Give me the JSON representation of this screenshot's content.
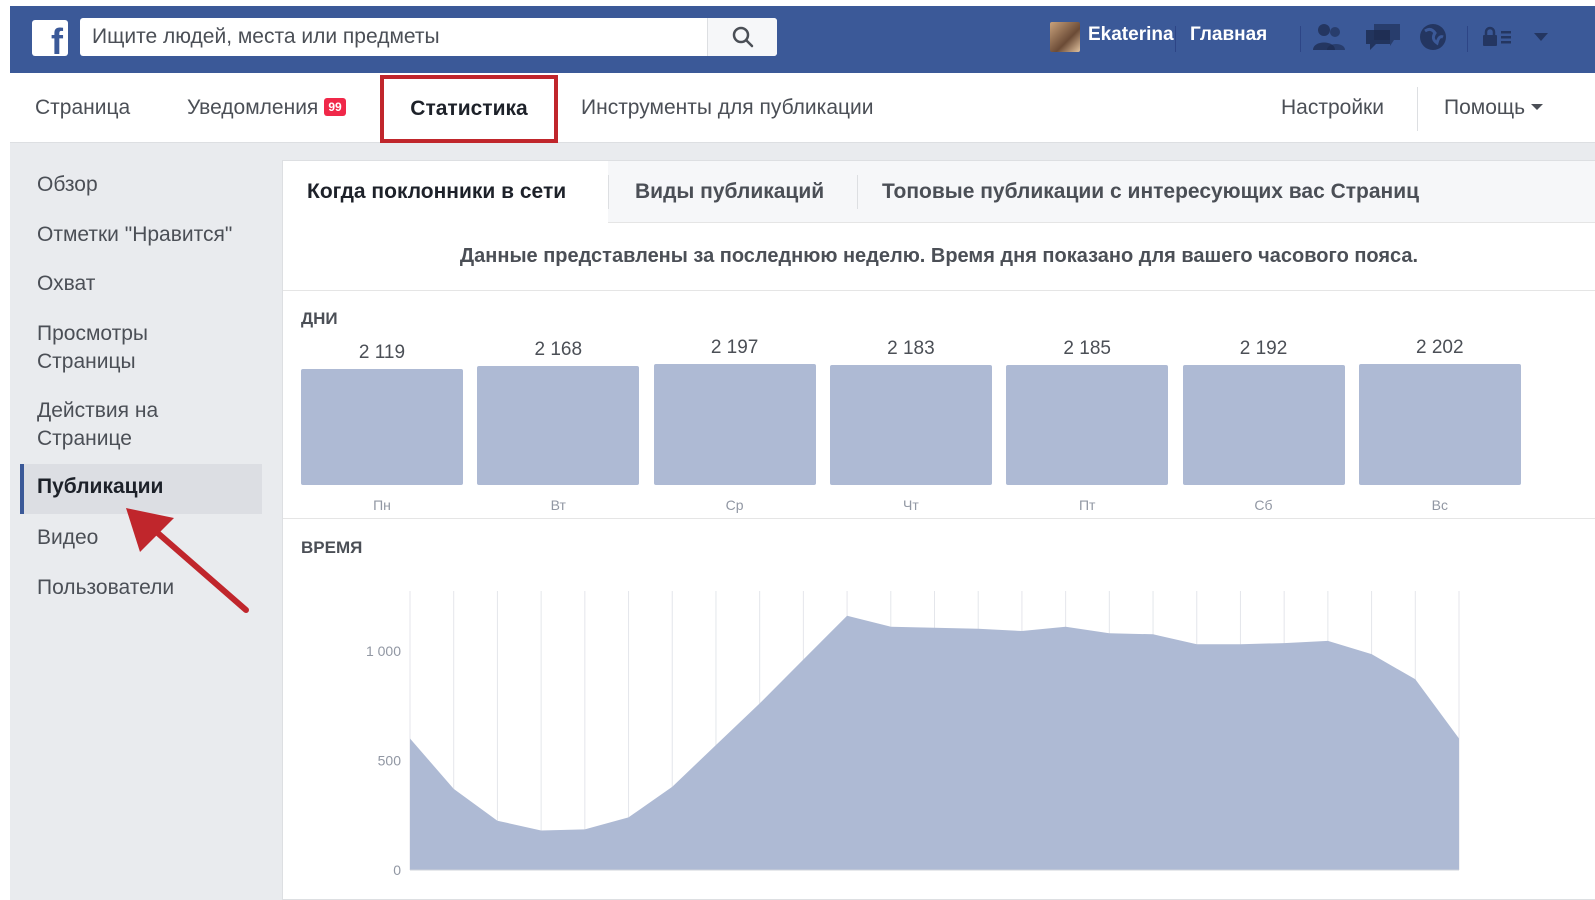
{
  "header": {
    "search_placeholder": "Ищите людей, места или предметы",
    "user_name": "Ekaterina",
    "home_label": "Главная",
    "brand_color": "#3b5998"
  },
  "page_nav": {
    "items": [
      {
        "label": "Страница"
      },
      {
        "label": "Уведомления",
        "badge": "99"
      },
      {
        "label": "Статистика",
        "active": true
      },
      {
        "label": "Инструменты для публикации"
      },
      {
        "label": "Настройки"
      },
      {
        "label": "Помощь"
      }
    ],
    "highlight_color": "#c0262c"
  },
  "sidebar": {
    "items": [
      {
        "label": "Обзор"
      },
      {
        "label": "Отметки \"Нравится\""
      },
      {
        "label": "Охват"
      },
      {
        "label": "Просмотры",
        "label2": "Страницы"
      },
      {
        "label": "Действия на",
        "label2": "Странице"
      },
      {
        "label": "Публикации",
        "active": true
      },
      {
        "label": "Видео"
      },
      {
        "label": "Пользователи"
      }
    ]
  },
  "tabs": [
    {
      "label": "Когда поклонники в сети",
      "active": true
    },
    {
      "label": "Виды публикаций"
    },
    {
      "label": "Топовые публикации с интересующих вас Страниц"
    }
  ],
  "notice": "Данные представлены за последнюю неделю. Время дня показано для вашего часового пояса.",
  "chart_data": [
    {
      "type": "bar",
      "title": "ДНИ",
      "categories": [
        "Пн",
        "Вт",
        "Ср",
        "Чт",
        "Пт",
        "Сб",
        "Вс"
      ],
      "values": [
        2119,
        2168,
        2197,
        2183,
        2185,
        2192,
        2202
      ],
      "value_labels": [
        "2 119",
        "2 168",
        "2 197",
        "2 183",
        "2 185",
        "2 192",
        "2 202"
      ],
      "color": "#aebad4"
    },
    {
      "type": "area",
      "title": "ВРЕМЯ",
      "x": [
        0,
        1,
        2,
        3,
        4,
        5,
        6,
        7,
        8,
        9,
        10,
        11,
        12,
        13,
        14,
        15,
        16,
        17,
        18,
        19,
        20,
        21,
        22,
        23,
        24
      ],
      "values": [
        600,
        370,
        225,
        180,
        185,
        240,
        380,
        570,
        760,
        960,
        1160,
        1110,
        1105,
        1100,
        1090,
        1110,
        1080,
        1075,
        1030,
        1030,
        1035,
        1045,
        985,
        870,
        600
      ],
      "yticks": [
        0,
        500,
        1000
      ],
      "ytick_labels": [
        "0",
        "500",
        "1 000"
      ],
      "ylim": [
        0,
        1300
      ],
      "grid": true,
      "color": "#aebad4"
    }
  ]
}
